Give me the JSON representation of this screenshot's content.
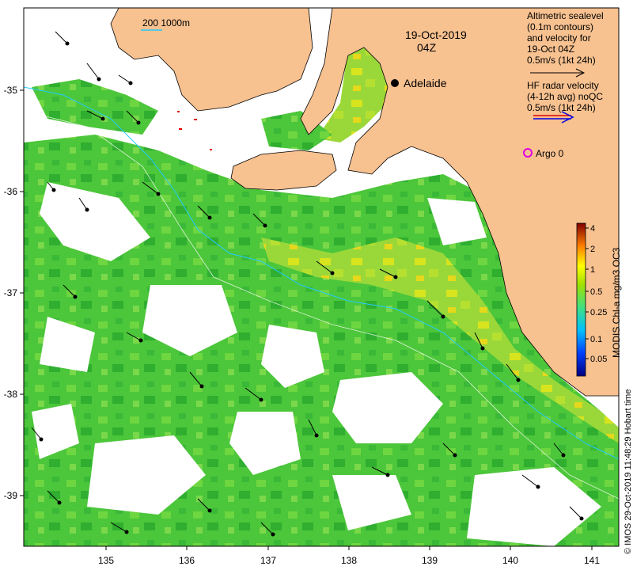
{
  "header": {
    "date": "19-Oct-2019",
    "time": "04Z",
    "scale_bar_label": "200  1000m"
  },
  "city": {
    "name": "Adelaide"
  },
  "legend": {
    "sealevel_lines": [
      "Altimetric sealevel",
      "(0.1m contours)",
      "and velocity for",
      "19-Oct 04Z",
      "0.5m/s (1kt 24h)"
    ],
    "radar_lines": [
      "HF radar velocity",
      "(4-12h avg) noQC",
      "0.5m/s (1kt 24h)"
    ],
    "argo_label": "Argo 0",
    "colors": {
      "argo": "#e000e0",
      "radar_red": "#e00000",
      "radar_blue": "#0000e0",
      "land": "#f7c190"
    }
  },
  "colorbar": {
    "title": "MODIS Chl-a mg/m3 OC3",
    "ticks": [
      "4",
      "2",
      "1",
      "0.5",
      "0.25",
      "0.1",
      "0.05"
    ]
  },
  "axes": {
    "x_ticks": [
      "135",
      "136",
      "137",
      "138",
      "139",
      "140",
      "141"
    ],
    "y_ticks": [
      "-35",
      "-36",
      "-37",
      "-38",
      "-39"
    ]
  },
  "credit": "© IMOS 29-Oct-2019 11:48:29 Hobart time"
}
